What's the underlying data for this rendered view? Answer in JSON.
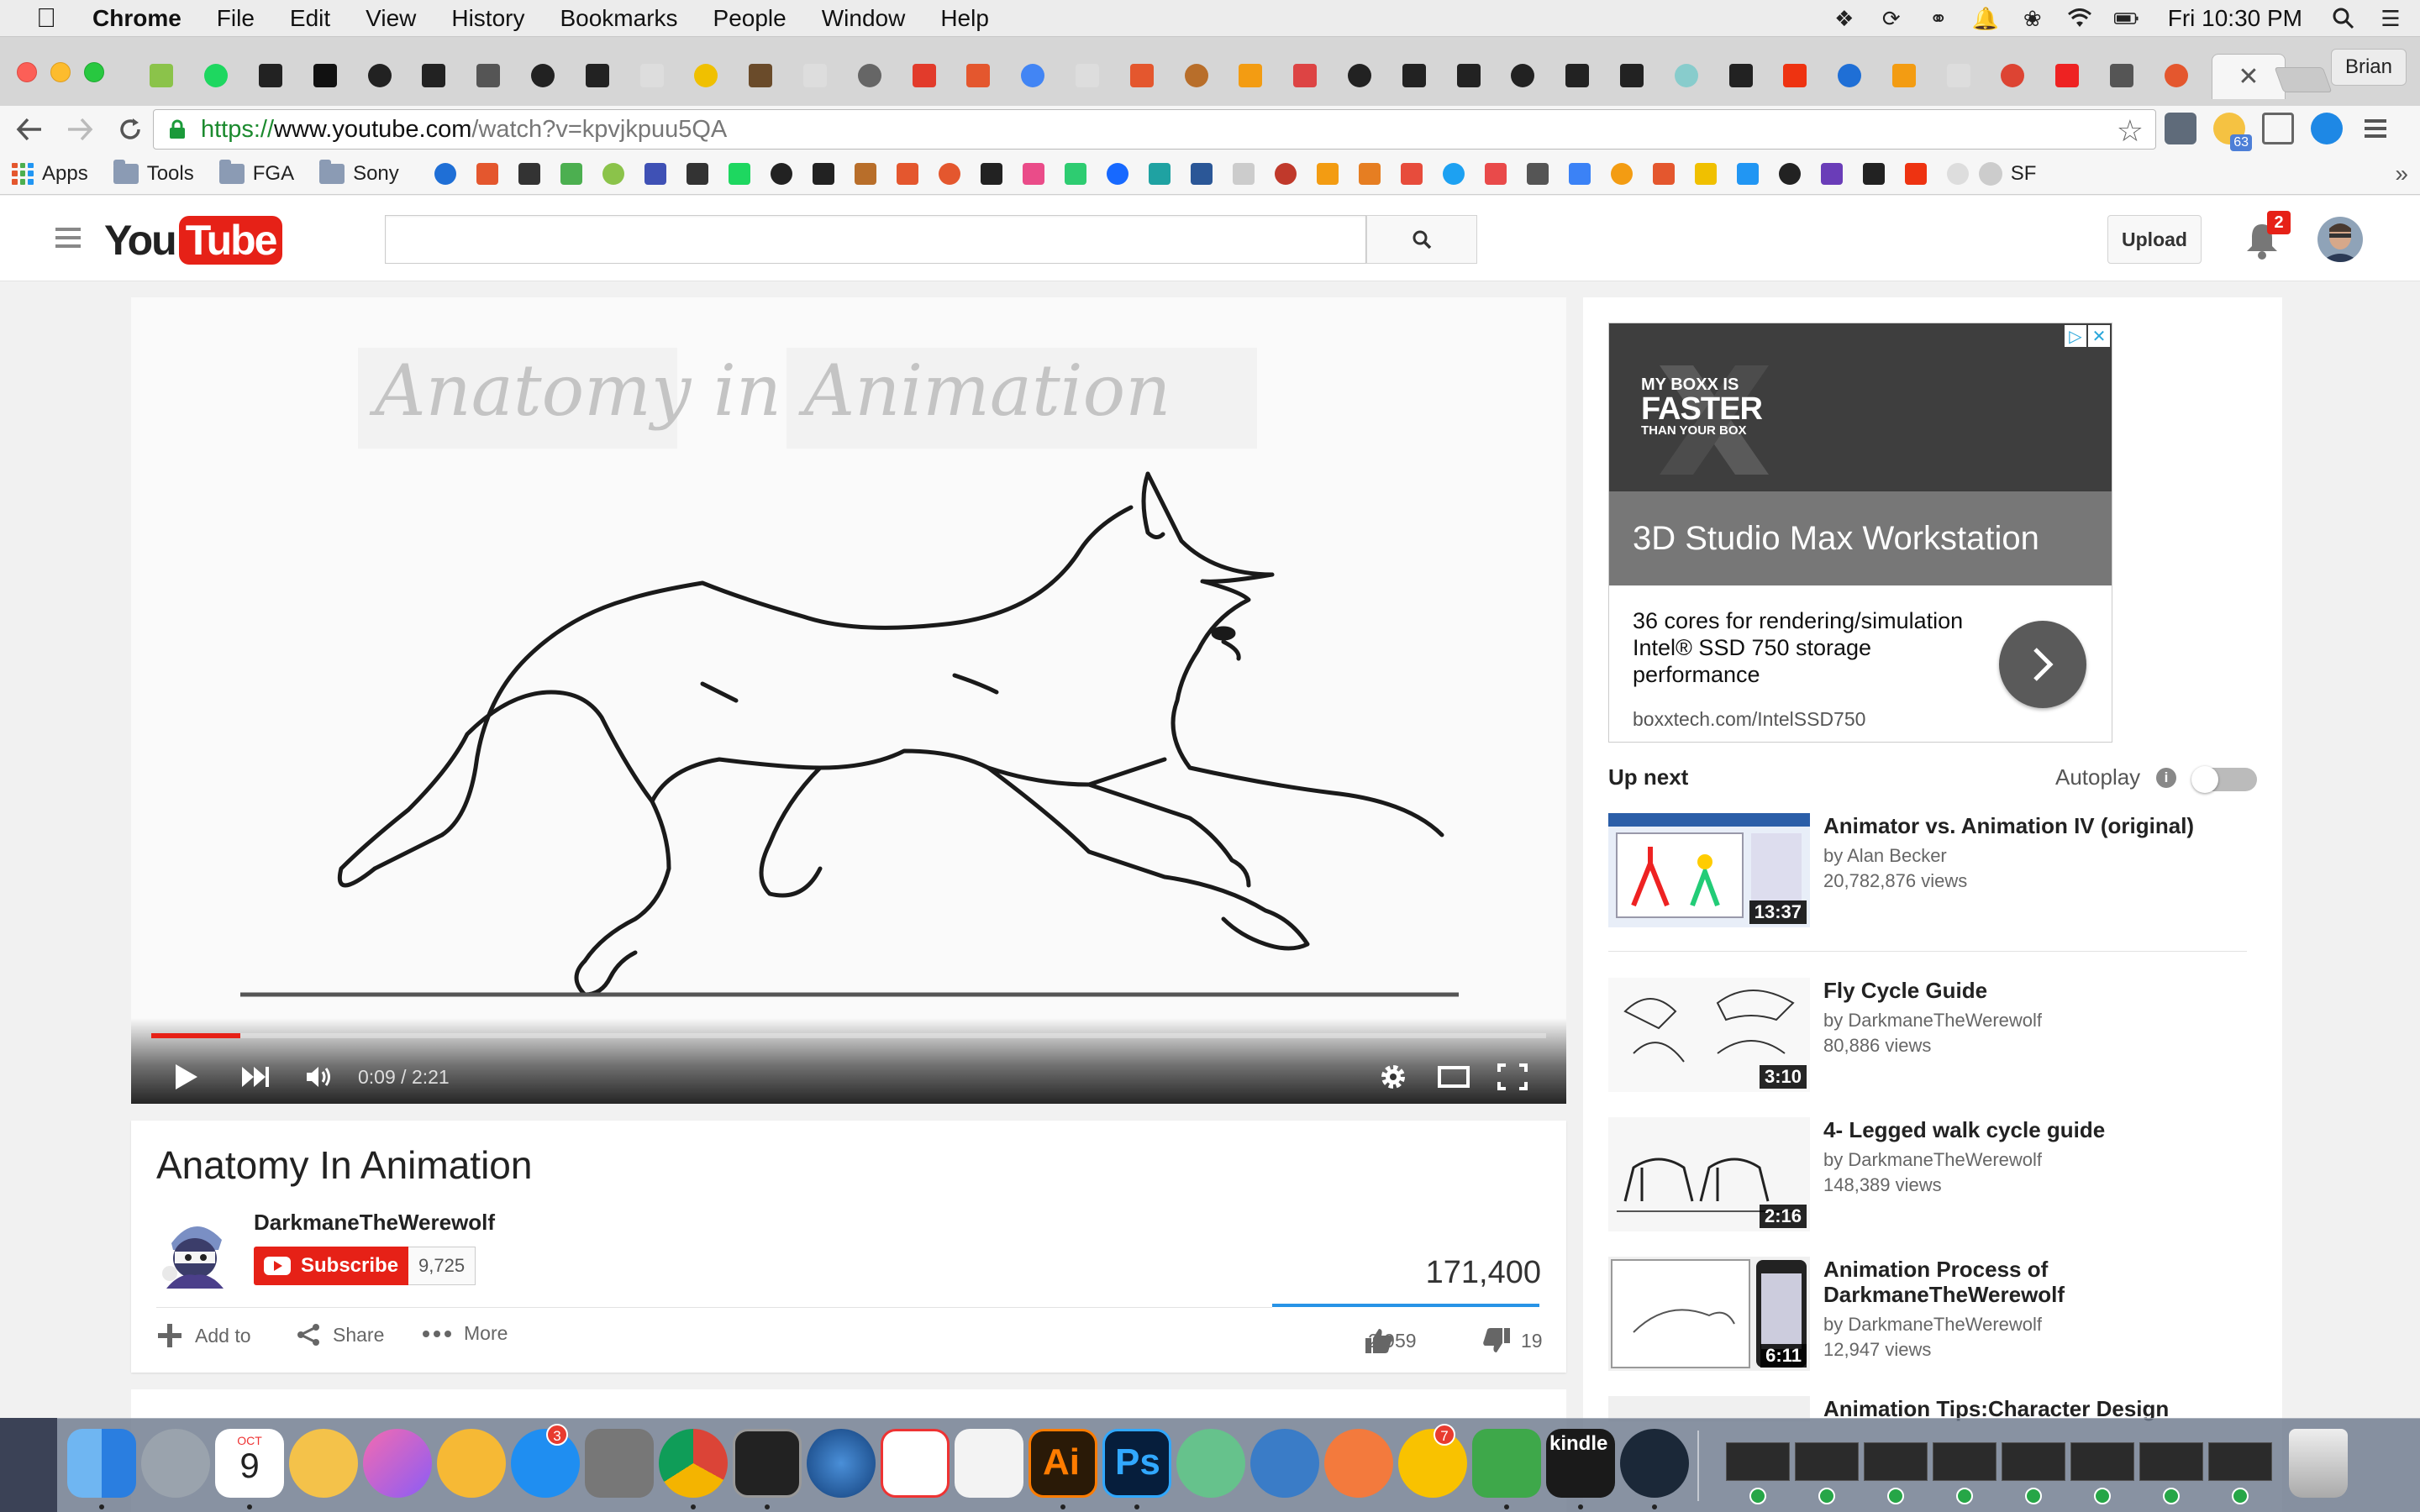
{
  "menubar": {
    "app": "Chrome",
    "items": [
      "File",
      "Edit",
      "View",
      "History",
      "Bookmarks",
      "People",
      "Window",
      "Help"
    ],
    "clock": "Fri 10:30 PM"
  },
  "browser": {
    "profile": "Brian",
    "url": {
      "scheme": "https://",
      "host": "www.youtube.com",
      "path": "/watch?v=kpvjkpuu5QA"
    },
    "pinned_tab_count": 38,
    "weather_badge": "63"
  },
  "bookmarks": {
    "apps_label": "Apps",
    "folders": [
      "Tools",
      "FGA",
      "Sony"
    ],
    "sf_label": "SF"
  },
  "youtube": {
    "logo_you": "You",
    "logo_tube": "Tube",
    "search_value": "",
    "upload_label": "Upload",
    "notification_count": "2"
  },
  "player": {
    "overlay_text": "Anatomy in Animation",
    "current_time": "0:09",
    "duration": "2:21",
    "progress": 0.064
  },
  "video": {
    "title": "Anatomy In Animation",
    "channel": "DarkmaneTheWerewolf",
    "subscribe_label": "Subscribe",
    "subscriber_count": "9,725",
    "views": "171,400",
    "actions": {
      "add_to": "Add to",
      "share": "Share",
      "more": "More"
    },
    "likes": "2,959",
    "dislikes": "19",
    "like_ratio": 0.994
  },
  "ad": {
    "brand_line1": "MY BOXX IS",
    "brand_line2": "FASTER",
    "brand_line3": "THAN YOUR BOX",
    "title": "3D Studio Max Workstation",
    "body": "36 cores for rendering/simulation Intel® SSD 750 storage performance",
    "url": "boxxtech.com/IntelSSD750"
  },
  "sidebar": {
    "up_next": "Up next",
    "autoplay": "Autoplay",
    "autoplay_on": false,
    "recommendations": [
      {
        "title": "Animator vs. Animation IV (original)",
        "by": "by Alan Becker",
        "views": "20,782,876 views",
        "duration": "13:37"
      },
      {
        "title": "Fly Cycle Guide",
        "by": "by DarkmaneTheWerewolf",
        "views": "80,886 views",
        "duration": "3:10"
      },
      {
        "title": "4- Legged walk cycle guide",
        "by": "by DarkmaneTheWerewolf",
        "views": "148,389 views",
        "duration": "2:16"
      },
      {
        "title": "Animation Process of DarkmaneTheWerewolf",
        "by": "by DarkmaneTheWerewolf",
        "views": "12,947 views",
        "duration": "6:11"
      },
      {
        "title": "Animation Tips:Character Design",
        "by": "",
        "views": "",
        "duration": ""
      }
    ]
  },
  "dock": {
    "calendar_month": "OCT",
    "calendar_day": "9",
    "appstore_badge": "3",
    "norton_badge": "7",
    "illustrator": "Ai",
    "photoshop": "Ps",
    "kindle": "kindle"
  }
}
